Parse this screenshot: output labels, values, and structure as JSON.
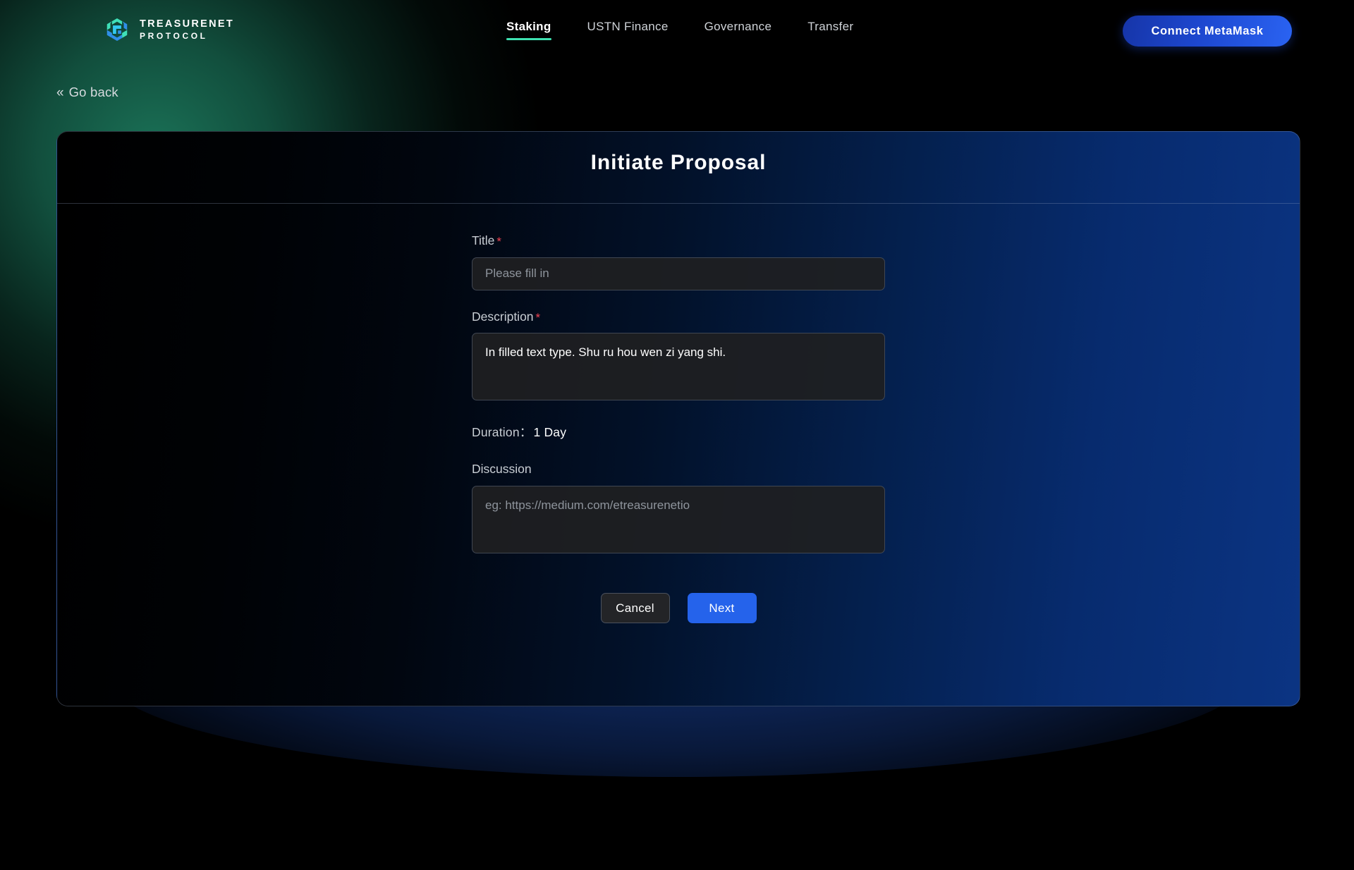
{
  "brand": {
    "line1": "TREASURENET",
    "line2": "PROTOCOL",
    "logo_icon": "treasurenet-logo-icon"
  },
  "nav": {
    "items": [
      {
        "label": "Staking",
        "active": true
      },
      {
        "label": "USTN Finance",
        "active": false
      },
      {
        "label": "Governance",
        "active": false
      },
      {
        "label": "Transfer",
        "active": false
      }
    ],
    "active_underline_color": "#3ee0b0"
  },
  "wallet": {
    "connect_label": "Connect MetaMask",
    "gradient_from": "#1635a8",
    "gradient_to": "#2a63f2"
  },
  "back": {
    "label": "Go back",
    "chevron_icon": "double-chevron-left-icon",
    "chevron_glyph": "«"
  },
  "card": {
    "title": "Initiate Proposal"
  },
  "form": {
    "title_field": {
      "label": "Title",
      "required": true,
      "required_marker": "*",
      "value": "",
      "placeholder": "Please fill in"
    },
    "description_field": {
      "label": "Description",
      "required": true,
      "required_marker": "*",
      "value": "In filled text type. Shu ru hou wen zi yang shi.",
      "placeholder": ""
    },
    "duration": {
      "label": "Duration：",
      "value": "1 Day"
    },
    "discussion_field": {
      "label": "Discussion",
      "required": false,
      "value": "",
      "placeholder": "eg: https://medium.com/etreasurenetio"
    }
  },
  "actions": {
    "cancel_label": "Cancel",
    "next_label": "Next",
    "next_color": "#2563eb"
  }
}
